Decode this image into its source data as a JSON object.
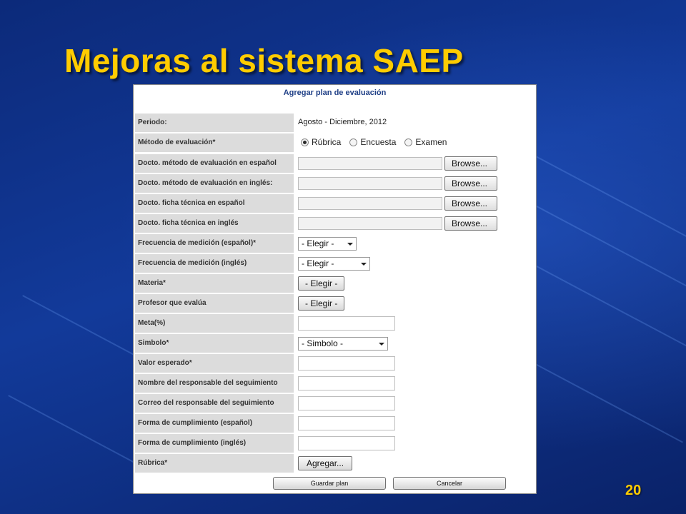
{
  "slide": {
    "title": "Mejoras al sistema SAEP",
    "page_number": "20"
  },
  "form": {
    "title": "Agregar plan de evaluación",
    "periodo": {
      "label": "Periodo:",
      "value": "Agosto - Diciembre, 2012"
    },
    "metodo": {
      "label": "Método de evaluación*",
      "options": [
        "Rúbrica",
        "Encuesta",
        "Examen"
      ],
      "selected": "Rúbrica"
    },
    "docto_metodo_es": {
      "label": "Docto. método de evaluación en español",
      "button": "Browse..."
    },
    "docto_metodo_en": {
      "label": "Docto. método de evaluación en inglés:",
      "button": "Browse..."
    },
    "docto_ficha_es": {
      "label": "Docto. ficha técnica en español",
      "button": "Browse..."
    },
    "docto_ficha_en": {
      "label": "Docto. ficha técnica en inglés",
      "button": "Browse..."
    },
    "frecuencia_es": {
      "label": "Frecuencia de medición (español)*",
      "selected": "- Elegir -"
    },
    "frecuencia_en": {
      "label": "Frecuencia de medición (inglés)",
      "selected": "- Elegir -"
    },
    "materia": {
      "label": "Materia*",
      "button": "- Elegir -"
    },
    "profesor": {
      "label": "Profesor que evalúa",
      "button": "- Elegir -"
    },
    "meta": {
      "label": "Meta(%)",
      "value": ""
    },
    "simbolo": {
      "label": "Simbolo*",
      "selected": "- Simbolo -"
    },
    "valor_esperado": {
      "label": "Valor esperado*",
      "value": ""
    },
    "nombre_responsable": {
      "label": "Nombre del responsable del seguimiento",
      "value": ""
    },
    "correo_responsable": {
      "label": "Correo del responsable del seguimiento",
      "value": ""
    },
    "forma_es": {
      "label": "Forma de cumplimiento (español)",
      "value": ""
    },
    "forma_en": {
      "label": "Forma de cumplimiento (inglés)",
      "value": ""
    },
    "rubrica": {
      "label": "Rúbrica*",
      "button": "Agregar..."
    },
    "save_button": "Guardar plan",
    "cancel_button": "Cancelar"
  },
  "colors": {
    "title_yellow": "#ffcc00",
    "form_title_blue": "#1f3f86",
    "label_bg": "#dcdcdc",
    "background_blue": "#123a9a"
  }
}
